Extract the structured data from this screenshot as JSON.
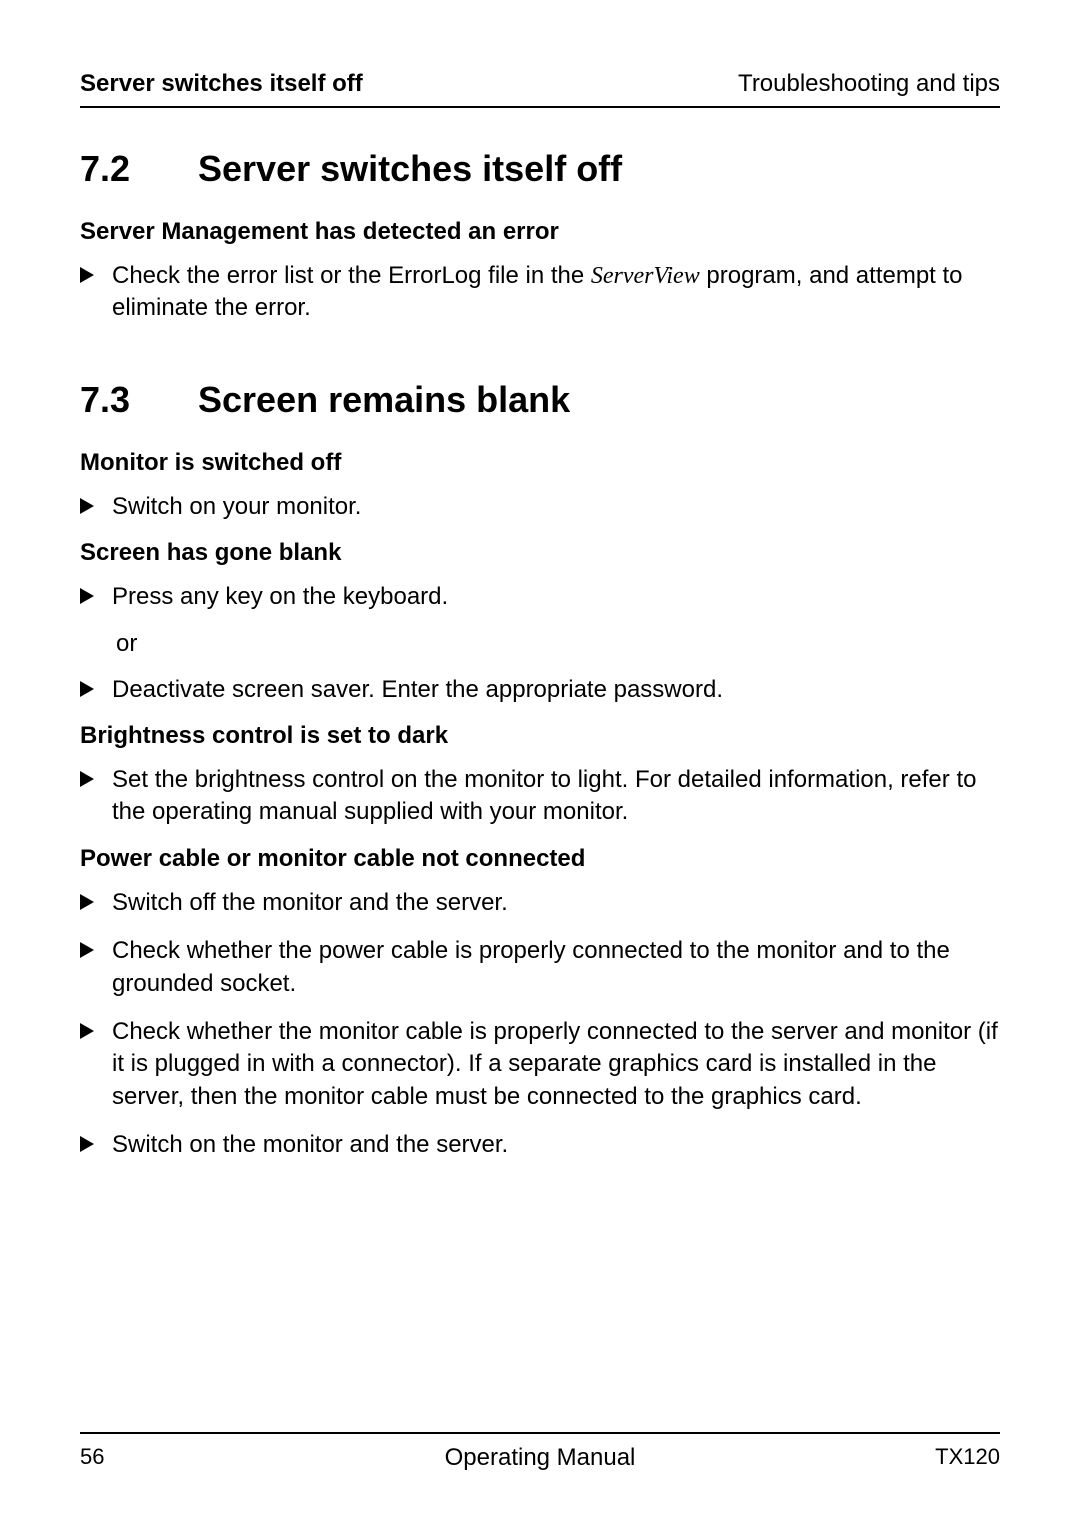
{
  "header": {
    "left": "Server switches itself off",
    "right": "Troubleshooting and tips"
  },
  "sections": [
    {
      "number": "7.2",
      "title": "Server switches itself off",
      "blocks": [
        {
          "subheading": "Server Management has detected an error",
          "items": [
            {
              "pre": "Check the error list or the ErrorLog file in the ",
              "italic": "ServerView",
              "post": " program, and attempt to eliminate the error."
            }
          ]
        }
      ]
    },
    {
      "number": "7.3",
      "title": "Screen remains blank",
      "blocks": [
        {
          "subheading": "Monitor is switched off",
          "items": [
            {
              "text": "Switch on your monitor."
            }
          ]
        },
        {
          "subheading": "Screen has gone blank",
          "items": [
            {
              "text": "Press any key on the keyboard."
            },
            {
              "connector": "or"
            },
            {
              "text": "Deactivate screen saver. Enter the appropriate password."
            }
          ]
        },
        {
          "subheading": "Brightness control is set to dark",
          "items": [
            {
              "text": "Set the brightness control on the monitor to light. For detailed information, refer to the operating manual supplied with your monitor."
            }
          ]
        },
        {
          "subheading": "Power cable or monitor cable not connected",
          "items": [
            {
              "text": "Switch off the monitor and the server."
            },
            {
              "text": "Check whether the power cable is properly connected to the monitor and to the grounded socket."
            },
            {
              "text": "Check whether the monitor cable is properly connected to the server and monitor (if it is plugged in with a connector). If a separate graphics card is installed in the server, then the monitor cable must be connected to the graphics card."
            },
            {
              "text": "Switch on the monitor and the server."
            }
          ]
        }
      ]
    }
  ],
  "footer": {
    "page_number": "56",
    "center": "Operating Manual",
    "right": "TX120"
  }
}
